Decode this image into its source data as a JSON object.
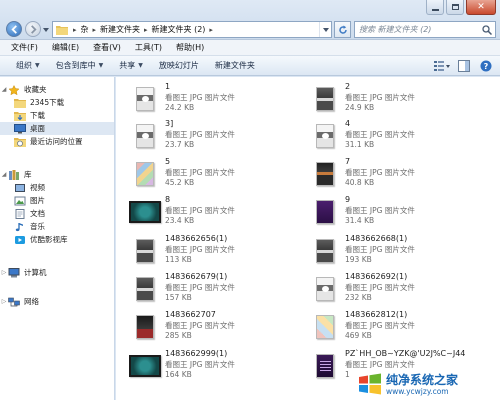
{
  "window": {
    "controls": [
      "minimize",
      "maximize",
      "close"
    ]
  },
  "address": {
    "crumbs": [
      "杂",
      "新建文件夹",
      "新建文件夹 (2)"
    ]
  },
  "search": {
    "placeholder": "搜索 新建文件夹 (2)"
  },
  "menu": [
    "文件(F)",
    "编辑(E)",
    "查看(V)",
    "工具(T)",
    "帮助(H)"
  ],
  "toolbar": {
    "organize": "组织",
    "include_in_library": "包含到库中",
    "share": "共享",
    "slideshow": "放映幻灯片",
    "new_folder": "新建文件夹"
  },
  "nav": {
    "favorites": "收藏夹",
    "fav_items": [
      "2345下载",
      "下载",
      "桌面",
      "最近访问的位置"
    ],
    "library": "库",
    "lib_items": [
      "视频",
      "图片",
      "文档",
      "音乐",
      "优酷影视库"
    ],
    "computer": "计算机",
    "network": "网络"
  },
  "files": [
    {
      "name": "1",
      "type": "看图王 JPG 图片文件",
      "size": "24.2 KB",
      "thumb": "t-gray"
    },
    {
      "name": "2",
      "type": "看图王 JPG 图片文件",
      "size": "24.9 KB",
      "thumb": "t-dark"
    },
    {
      "name": "3]",
      "type": "看图王 JPG 图片文件",
      "size": "23.7 KB",
      "thumb": "t-gray"
    },
    {
      "name": "4",
      "type": "看图王 JPG 图片文件",
      "size": "31.1 KB",
      "thumb": "t-gray"
    },
    {
      "name": "5",
      "type": "看图王 JPG 图片文件",
      "size": "45.2 KB",
      "thumb": "t-colorful"
    },
    {
      "name": "7",
      "type": "看图王 JPG 图片文件",
      "size": "40.8 KB",
      "thumb": "t-darkcoll"
    },
    {
      "name": "8",
      "type": "看图王 JPG 图片文件",
      "size": "23.4 KB",
      "thumb": "t-teal"
    },
    {
      "name": "9",
      "type": "看图王 JPG 图片文件",
      "size": "31.4 KB",
      "thumb": "t-purple"
    },
    {
      "name": "1483662656(1)",
      "type": "看图王 JPG 图片文件",
      "size": "113 KB",
      "thumb": "t-dark"
    },
    {
      "name": "1483662668(1)",
      "type": "看图王 JPG 图片文件",
      "size": "193 KB",
      "thumb": "t-dark"
    },
    {
      "name": "1483662679(1)",
      "type": "看图王 JPG 图片文件",
      "size": "157 KB",
      "thumb": "t-dark"
    },
    {
      "name": "1483662692(1)",
      "type": "看图王 JPG 图片文件",
      "size": "232 KB",
      "thumb": "t-gray"
    },
    {
      "name": "1483662707",
      "type": "看图王 JPG 图片文件",
      "size": "285 KB",
      "thumb": "t-dark-red"
    },
    {
      "name": "1483662812(1)",
      "type": "看图王 JPG 图片文件",
      "size": "469 KB",
      "thumb": "t-colorful2"
    },
    {
      "name": "1483662999(1)",
      "type": "看图王 JPG 图片文件",
      "size": "164 KB",
      "thumb": "t-teal"
    },
    {
      "name": "PZ`HH_OB~YZK@'U2J%C~J44",
      "type": "看图王 JPG 图片文件",
      "size": "1",
      "thumb": "t-purple-lines"
    }
  ],
  "watermark": {
    "title": "纯净系统之家",
    "url": "www.ycwjzy.com"
  }
}
